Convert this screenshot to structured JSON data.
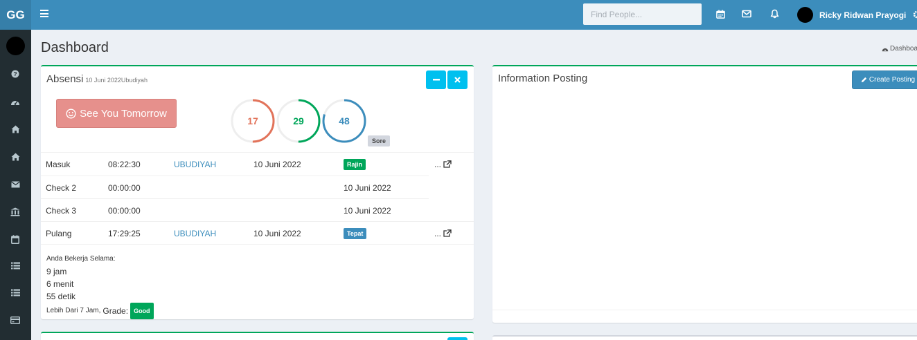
{
  "app": {
    "logo": "GG"
  },
  "header": {
    "search_placeholder": "Find People...",
    "icons": [
      "calendar-icon",
      "envelope-icon",
      "bell-icon",
      "gear-icon"
    ],
    "user_name": "Ricky Ridwan Prayogi"
  },
  "sidebar": {
    "items": [
      "question-icon",
      "dashboard-icon",
      "home-icon",
      "home-icon",
      "envelope-icon",
      "bank-icon",
      "calendar-icon",
      "list-icon",
      "list-icon",
      "credit-card-icon"
    ]
  },
  "page": {
    "title": "Dashboard",
    "breadcrumb": "Dashboa"
  },
  "absensi": {
    "title": "Absensi",
    "date": "10 Juni 2022",
    "location": "Ubudiyah",
    "see_button": "See You Tomorrow",
    "rings": [
      {
        "value": "17",
        "color": "#e2735a",
        "fill": 0.5
      },
      {
        "value": "29",
        "color": "#00a65a",
        "fill": 0.5
      },
      {
        "value": "48",
        "color": "#3c8dbc",
        "fill": 0.8
      }
    ],
    "sore_label": "Sore",
    "rows": [
      {
        "name": "Masuk",
        "time": "08:22:30",
        "location": "UBUDIYAH",
        "date": "10 Juni 2022",
        "badge": "Rajin",
        "badge_color": "green",
        "more": "..."
      },
      {
        "name": "Check 2",
        "time": "00:00:00",
        "location": "",
        "date": "",
        "badge": "10 Juni 2022",
        "badge_color": "",
        "more": ""
      },
      {
        "name": "Check 3",
        "time": "00:00:00",
        "location": "",
        "date": "",
        "badge": "10 Juni 2022",
        "badge_color": "",
        "more": ""
      },
      {
        "name": "Pulang",
        "time": "17:29:25",
        "location": "UBUDIYAH",
        "date": "10 Juni 2022",
        "badge": "Tepat",
        "badge_color": "blue",
        "more": "..."
      }
    ],
    "summary": {
      "heading": "Anda Bekerja Selama:",
      "hours": "9 jam",
      "minutes": "6 menit",
      "seconds": "55 detik",
      "note": "Lebih Dari 7 Jam,",
      "grade_label": "Grade:",
      "grade": "Good"
    }
  },
  "info_posting": {
    "title": "Information Posting",
    "create_button": "Create Posting"
  }
}
